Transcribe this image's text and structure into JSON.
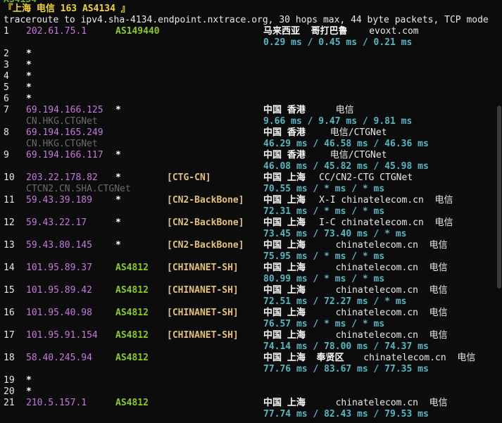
{
  "header": {
    "location_line": "『上海 电信 163 AS4134 』",
    "command_line": "traceroute to ipv4.sha-4134.endpoint.nxtrace.org, 30 hops max, 44 byte packets, TCP mode"
  },
  "hops": [
    {
      "n": "1",
      "ip": "202.61.75.1",
      "as": "AS149440",
      "tag": "",
      "geo": "马来西亚  哥打巴鲁",
      "org": "evoxt.com",
      "rdns": "",
      "rtt": "0.29 ms / 0.45 ms / 0.21 ms"
    },
    {
      "n": "2",
      "ip": "*"
    },
    {
      "n": "3",
      "ip": "*"
    },
    {
      "n": "4",
      "ip": "*"
    },
    {
      "n": "5",
      "ip": "*"
    },
    {
      "n": "6",
      "ip": "*"
    },
    {
      "n": "7",
      "ip": "69.194.166.125",
      "as": "*",
      "tag": "",
      "geo": "中国 香港",
      "org": "   电信",
      "rdns": "CN.HKG.CTGNet",
      "rtt": "9.66 ms / 9.47 ms / 9.81 ms"
    },
    {
      "n": "8",
      "ip": "69.194.165.249",
      "as": "",
      "tag": "",
      "geo": "中国 香港",
      "org": "  电信/CTGNet",
      "rdns": "CN.HKG.CTGNet",
      "rtt": "46.29 ms / 46.58 ms / 46.36 ms"
    },
    {
      "n": "9",
      "ip": "69.194.166.117",
      "as": "*",
      "tag": "",
      "geo": "中国 香港",
      "org": "  电信/CTGNet",
      "rdns": "",
      "rtt": "46.08 ms / 45.82 ms / 45.98 ms"
    },
    {
      "n": "10",
      "ip": "203.22.178.82",
      "as": "*",
      "tag": "[CTG-CN]",
      "geo": "中国 上海",
      "org": "CC/CN2-CTG CTGNet",
      "rdns": "CTCN2.CN.SHA.CTGNet",
      "rtt": "70.55 ms / * ms / * ms"
    },
    {
      "n": "11",
      "ip": "59.43.39.189",
      "as": "*",
      "tag": "[CN2-BackBone]",
      "geo": "中国 上海",
      "org": "X-I chinatelecom.cn  电信",
      "rdns": "",
      "rtt": "72.31 ms / * ms / * ms"
    },
    {
      "n": "12",
      "ip": "59.43.22.17",
      "as": "*",
      "tag": "[CN2-BackBone]",
      "geo": "中国 上海",
      "org": "I-C chinatelecom.cn  电信",
      "rdns": "",
      "rtt": "73.45 ms / 73.40 ms / * ms"
    },
    {
      "n": "13",
      "ip": "59.43.80.145",
      "as": "*",
      "tag": "[CN2-BackBone]",
      "geo": "中国 上海",
      "org": "   chinatelecom.cn  电信",
      "rdns": "",
      "rtt": "75.95 ms / * ms / * ms"
    },
    {
      "n": "14",
      "ip": "101.95.89.37",
      "as": "AS4812",
      "tag": "[CHINANET-SH]",
      "geo": "中国 上海",
      "org": "   chinatelecom.cn  电信",
      "rdns": "",
      "rtt": "80.99 ms / * ms / * ms"
    },
    {
      "n": "15",
      "ip": "101.95.89.42",
      "as": "AS4812",
      "tag": "[CHINANET-SH]",
      "geo": "中国 上海",
      "org": "   chinatelecom.cn  电信",
      "rdns": "",
      "rtt": "72.51 ms / 72.27 ms / * ms"
    },
    {
      "n": "16",
      "ip": "101.95.40.98",
      "as": "AS4812",
      "tag": "[CHINANET-SH]",
      "geo": "中国 上海",
      "org": "   chinatelecom.cn  电信",
      "rdns": "",
      "rtt": "76.57 ms / * ms / * ms"
    },
    {
      "n": "17",
      "ip": "101.95.91.154",
      "as": "AS4812",
      "tag": "[CHINANET-SH]",
      "geo": "中国 上海",
      "org": "   chinatelecom.cn  电信",
      "rdns": "",
      "rtt": "74.14 ms / 78.00 ms / 74.37 ms"
    },
    {
      "n": "18",
      "ip": "58.40.245.94",
      "as": "AS4812",
      "tag": "",
      "geo": "中国 上海  奉贤区",
      "org": "chinatelecom.cn  电信",
      "rdns": "",
      "rtt": "77.76 ms / 83.67 ms / 77.35 ms"
    },
    {
      "n": "19",
      "ip": "*"
    },
    {
      "n": "20",
      "ip": "*"
    },
    {
      "n": "21",
      "ip": "210.5.157.1",
      "as": "AS4812",
      "tag": "",
      "geo": "中国 上海",
      "org": "   chinatelecom.cn  电信",
      "rdns": "",
      "rtt": "77.74 ms / 82.43 ms / 79.53 ms"
    }
  ]
}
